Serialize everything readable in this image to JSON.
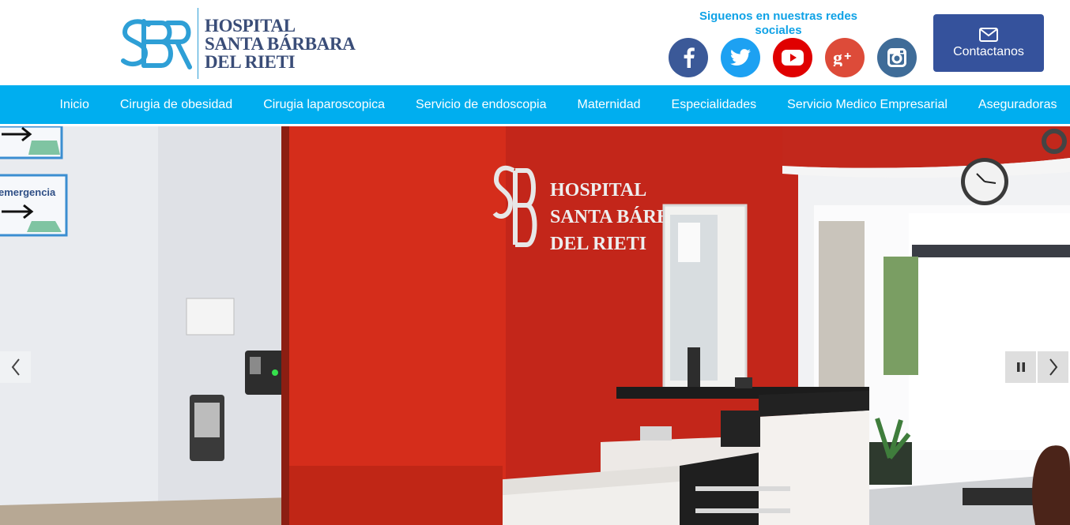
{
  "logo": {
    "monogram": "SBR",
    "line1": "HOSPITAL",
    "line2": "SANTA BÁRBARA",
    "line3": "DEL RIETI"
  },
  "social": {
    "title": "Siguenos en nuestras redes sociales",
    "items": [
      {
        "name": "facebook-icon",
        "color": "#3b5998"
      },
      {
        "name": "twitter-icon",
        "color": "#1da1f2"
      },
      {
        "name": "youtube-icon",
        "color": "#e00000"
      },
      {
        "name": "google-plus-icon",
        "color": "#dd4b39"
      },
      {
        "name": "instagram-icon",
        "color": "#3f6c98"
      }
    ]
  },
  "contact": {
    "label": "Contactanos",
    "icon": "envelope-icon",
    "color": "#35529c"
  },
  "nav": {
    "color": "#00aeef",
    "items": [
      "Inicio",
      "Cirugia de obesidad",
      "Cirugia laparoscopica",
      "Servicio de endoscopia",
      "Maternidad",
      "Especialidades",
      "Servicio Medico Empresarial",
      "Aseguradoras"
    ]
  },
  "slider": {
    "sign_text": "emergencia",
    "wall_logo_line1": "HOSPITAL",
    "wall_logo_line2": "SANTA BÁRBARA",
    "wall_logo_line3": "DEL RIETI",
    "prev_icon": "chevron-left-icon",
    "next_icon": "chevron-right-icon",
    "pause_icon": "pause-icon"
  }
}
